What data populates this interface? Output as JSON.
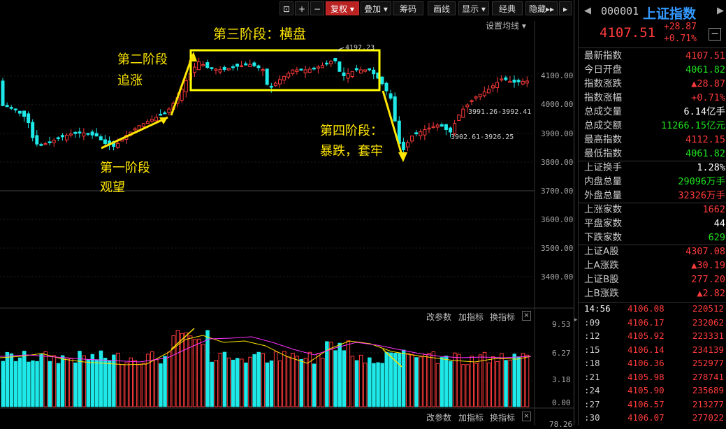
{
  "toolbar": {
    "buttons": [
      "复权",
      "叠加",
      "筹码",
      "画线",
      "显示",
      "经典",
      "隐藏"
    ]
  },
  "chart": {
    "ma_setting": "设置均线",
    "y_ticks": [
      "4100.00",
      "4000.00",
      "3900.00",
      "3800.00",
      "3700.00",
      "3600.00",
      "3500.00",
      "3400.00"
    ],
    "high_label": "4197.23",
    "range_label_1": "3991.26-3992.41",
    "range_label_2": "3902.61-3926.25",
    "annotations": {
      "stage1_line1": "第一阶段",
      "stage1_line2": "观望",
      "stage2_line1": "第二阶段",
      "stage2_line2": "追涨",
      "stage3": "第三阶段：横盘",
      "stage4_line1": "第四阶段：",
      "stage4_line2": "暴跌，套牢"
    },
    "volume_links": [
      "改参数",
      "加指标",
      "换指标"
    ],
    "volume_ticks": [
      "9.53",
      "6.27",
      "3.18",
      "0.00"
    ],
    "bottom_links": [
      "改参数",
      "加指标",
      "换指标"
    ],
    "bottom_tick": "78.26",
    "up_color": "#ff3b3b",
    "down_color": "#1ee8e8",
    "box_color": "#ffff00"
  },
  "quote": {
    "code": "000001",
    "name": "上证指数",
    "price": "4107.51",
    "change": "+28.87",
    "change_pct": "+0.71%",
    "rows": [
      {
        "label": "最新指数",
        "value": "4107.51",
        "color": "red"
      },
      {
        "label": "今日开盘",
        "value": "4061.82",
        "color": "green"
      },
      {
        "label": "指数涨跌",
        "value": "▲28.87",
        "color": "red"
      },
      {
        "label": "指数涨幅",
        "value": "+0.71%",
        "color": "red"
      },
      {
        "label": "总成交量",
        "value": "6.14亿手",
        "color": "white"
      },
      {
        "label": "总成交额",
        "value": "11266.15亿元",
        "color": "green"
      },
      {
        "label": "最高指数",
        "value": "4112.15",
        "color": "red"
      },
      {
        "label": "最低指数",
        "value": "4061.82",
        "color": "green"
      },
      {
        "label": "上证换手",
        "value": "1.28%",
        "color": "white"
      },
      {
        "label": "内盘总量",
        "value": "29096万手",
        "color": "green"
      },
      {
        "label": "外盘总量",
        "value": "32326万手",
        "color": "red"
      },
      {
        "label": "上涨家数",
        "value": "1662",
        "color": "red"
      },
      {
        "label": "平盘家数",
        "value": "44",
        "color": "white"
      },
      {
        "label": "下跌家数",
        "value": "629",
        "color": "green"
      },
      {
        "label": "上证A股",
        "value": "4307.08",
        "color": "red"
      },
      {
        "label": "上A涨跌",
        "value": "▲30.19",
        "color": "red"
      },
      {
        "label": "上证B股",
        "value": "277.20",
        "color": "red"
      },
      {
        "label": "上B涨跌",
        "value": "▲2.82",
        "color": "red"
      }
    ],
    "ticks": [
      {
        "time": "14:56",
        "price": "4106.08",
        "vol": "220512"
      },
      {
        "time": ":09",
        "price": "4106.17",
        "vol": "232062"
      },
      {
        "time": ":12",
        "price": "4105.92",
        "vol": "223331"
      },
      {
        "time": ":15",
        "price": "4106.14",
        "vol": "234139"
      },
      {
        "time": ":18",
        "price": "4106.36",
        "vol": "252977"
      },
      {
        "time": ":21",
        "price": "4105.98",
        "vol": "278741"
      },
      {
        "time": ":24",
        "price": "4105.90",
        "vol": "235689"
      },
      {
        "time": ":27",
        "price": "4106.57",
        "vol": "213277"
      },
      {
        "time": ":30",
        "price": "4106.07",
        "vol": "277022"
      }
    ]
  }
}
